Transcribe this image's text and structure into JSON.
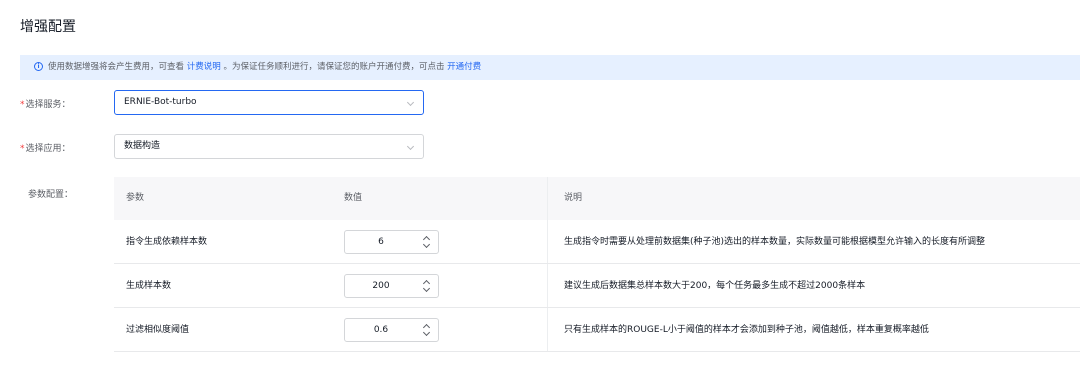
{
  "page": {
    "title": "增强配置"
  },
  "notice": {
    "text_before": "使用数据增强将会产生费用，可查看",
    "link1": "计费说明",
    "text_middle": "。为保证任务顺利进行，请保证您的账户开通付费，可点击",
    "link2": "开通付费"
  },
  "service": {
    "required_mark": "*",
    "label": "选择服务：",
    "value": "ERNIE-Bot-turbo"
  },
  "application": {
    "required_mark": "*",
    "label": "选择应用：",
    "value": "数据构造"
  },
  "params": {
    "label": "参数配置：",
    "headers": {
      "param": "参数",
      "value": "数值",
      "desc": "说明"
    },
    "rows": [
      {
        "name": "指令生成依赖样本数",
        "value": "6",
        "desc": "生成指令时需要从处理前数据集(种子池)选出的样本数量，实际数量可能根据模型允许输入的长度有所调整"
      },
      {
        "name": "生成样本数",
        "value": "200",
        "desc": "建议生成后数据集总样本数大于200，每个任务最多生成不超过2000条样本"
      },
      {
        "name": "过滤相似度阈值",
        "value": "0.6",
        "desc": "只有生成样本的ROUGE-L小于阈值的样本才会添加到种子池，阈值越低，样本重复概率越低"
      }
    ]
  }
}
